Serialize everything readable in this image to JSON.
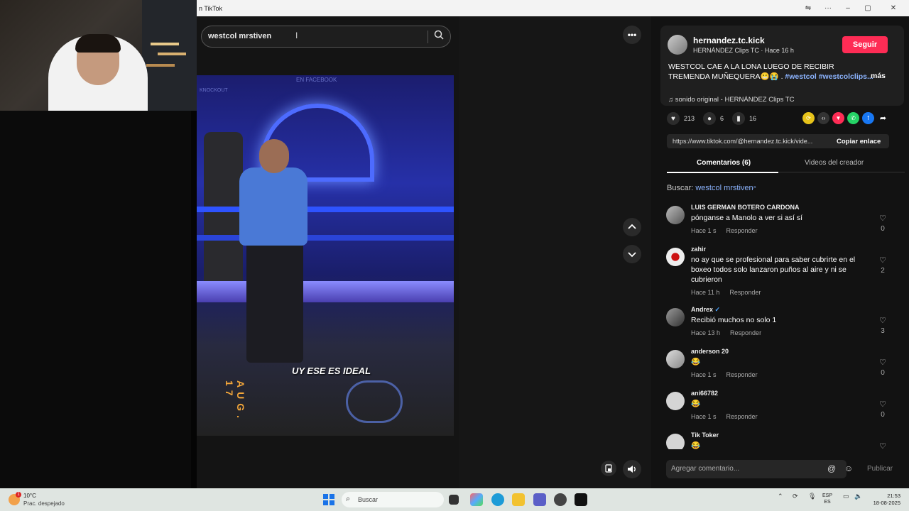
{
  "window": {
    "title": "n TikTok",
    "controls": {
      "translate": "⇋",
      "menu": "···",
      "minimize": "–",
      "maximize": "▢",
      "close": "✕"
    }
  },
  "search": {
    "query": "westcol mrstiven",
    "icon": "search-icon"
  },
  "video": {
    "caption": "UY ESE ES IDEAL",
    "date_overlay": "AUG. 17",
    "watermark_top": "EN FACEBOOK",
    "watermark_left": "KNOCKOUT"
  },
  "nav": {
    "more": "•••",
    "up": "⌃",
    "down": "⌄",
    "miniplayer": "▯",
    "volume": "🔊"
  },
  "creator": {
    "username": "hernandez.tc.kick",
    "subtitle": "HERNÁNDEZ Clips TC · Hace 16 h",
    "follow_label": "Seguir",
    "desc_text": "WESTCOL CAE A LA LONA LUEGO DE RECIBIR TREMENDA MUÑEQUERA😬😭 .",
    "desc_tag1": "#westcol",
    "desc_tag2": "#westcolclips...",
    "more_label": "más",
    "music": "♫  sonido original - HERNÁNDEZ Clips TC"
  },
  "stats": {
    "likes": "213",
    "comments": "6",
    "saves": "16"
  },
  "share": {
    "link": "https://www.tiktok.com/@hernandez.tc.kick/vide...",
    "copy_label": "Copiar enlace"
  },
  "tabs": {
    "comments": "Comentarios (6)",
    "creator_videos": "Videos del creador"
  },
  "search_suggestion": {
    "prefix": "Buscar:",
    "term": "westcol mrstiven"
  },
  "comments": [
    {
      "user": "LUIS GERMAN BOTERO CARDONA",
      "text": "pónganse a Manolo a ver si así sí",
      "time": "Hace 1 s",
      "reply": "Responder",
      "likes": "0"
    },
    {
      "user": "zahir",
      "text": "no ay que se profesional para saber cubrirte en el boxeo todos solo lanzaron puños al aire y ni se cubrieron",
      "time": "Hace 11 h",
      "reply": "Responder",
      "likes": "2"
    },
    {
      "user": "Andrex",
      "text": "Recibió muchos no solo 1",
      "time": "Hace 13 h",
      "reply": "Responder",
      "likes": "3"
    },
    {
      "user": "anderson 20",
      "text": "😂",
      "time": "Hace 1 s",
      "reply": "Responder",
      "likes": "0"
    },
    {
      "user": "ani66782",
      "text": "😂",
      "time": "Hace 1 s",
      "reply": "Responder",
      "likes": "0"
    },
    {
      "user": "Tik Toker",
      "text": "😂",
      "time": "",
      "reply": "",
      "likes": ""
    }
  ],
  "composer": {
    "placeholder": "Agregar comentario...",
    "publish": "Publicar"
  },
  "taskbar": {
    "weather_temp": "10°C",
    "weather_desc": "Prac. despejado",
    "search_label": "Buscar",
    "lang_1": "ESP",
    "lang_2": "ES",
    "time": "21:53",
    "date": "18-08-2025"
  },
  "colors": {
    "accent": "#fe2c55",
    "hashtag": "#8cb4ff",
    "bg": "#121212"
  }
}
